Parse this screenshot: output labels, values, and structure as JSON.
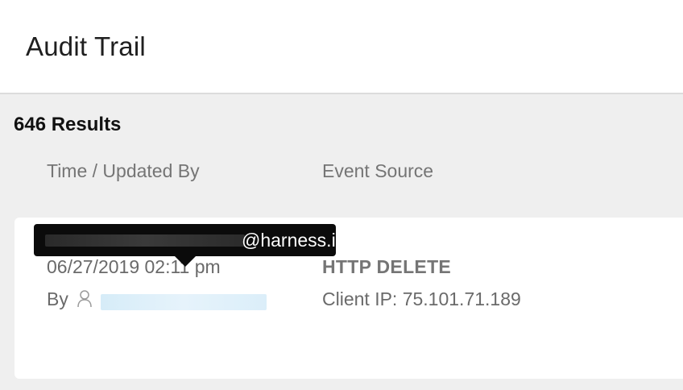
{
  "header": {
    "title": "Audit Trail"
  },
  "results": {
    "count_label": "646 Results"
  },
  "columns": {
    "time_updated_by": "Time / Updated By",
    "event_source": "Event Source"
  },
  "audit_entry": {
    "time": "06/27/2019 02:11 pm",
    "by_label": "By",
    "user_icon": "user-icon",
    "method": "HTTP DELETE",
    "client_ip": "Client IP: 75.101.71.189"
  },
  "tooltip": {
    "email_domain": "@harness.io"
  },
  "colors": {
    "header_bg": "#ffffff",
    "page_bg": "#efefef",
    "tooltip_bg": "#0b0b0b",
    "link_highlight": "#d6ecf8"
  }
}
